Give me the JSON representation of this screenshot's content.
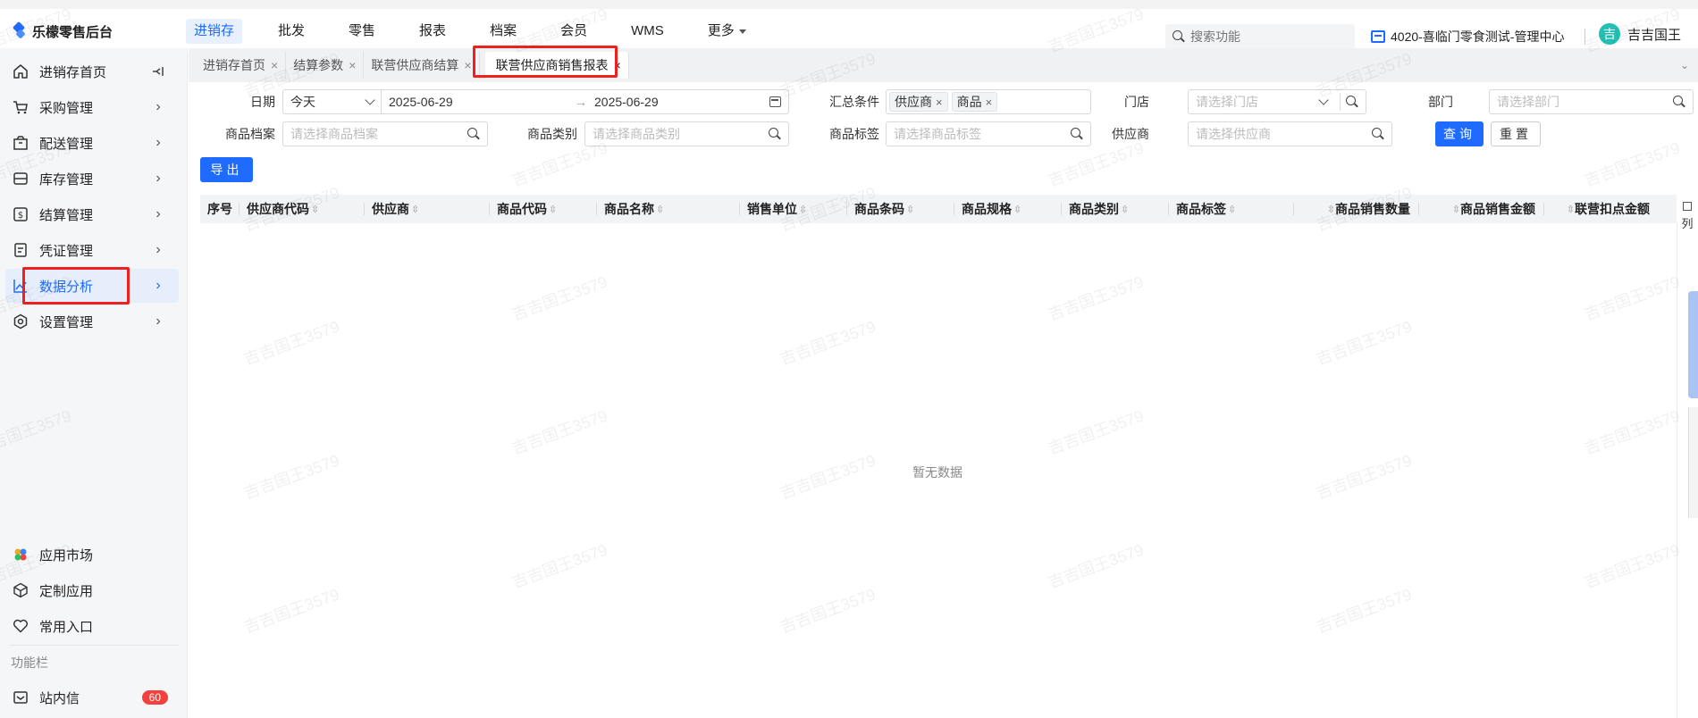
{
  "app": {
    "title": "乐檬零售后台"
  },
  "topnav": {
    "items": [
      "进销存",
      "批发",
      "零售",
      "报表",
      "档案",
      "会员",
      "WMS",
      "更多"
    ],
    "active": "进销存"
  },
  "search": {
    "placeholder": "搜索功能"
  },
  "org": {
    "name": "4020-喜临门零食测试-管理中心"
  },
  "user": {
    "avatar_char": "吉",
    "name": "吉吉国王"
  },
  "sidebar": {
    "items": [
      {
        "label": "进销存首页",
        "icon": "home-icon"
      },
      {
        "label": "采购管理",
        "icon": "cart-icon"
      },
      {
        "label": "配送管理",
        "icon": "box-icon"
      },
      {
        "label": "库存管理",
        "icon": "inventory-icon"
      },
      {
        "label": "结算管理",
        "icon": "dollar-icon"
      },
      {
        "label": "凭证管理",
        "icon": "document-icon"
      },
      {
        "label": "数据分析",
        "icon": "chart-icon"
      },
      {
        "label": "设置管理",
        "icon": "settings-icon"
      }
    ],
    "bottom": [
      {
        "label": "应用市场",
        "icon": "app-market-icon"
      },
      {
        "label": "定制应用",
        "icon": "cube-icon"
      },
      {
        "label": "常用入口",
        "icon": "heart-icon"
      }
    ],
    "section_title": "功能栏",
    "inbox": {
      "label": "站内信",
      "count": "60"
    },
    "active_label": "数据分析"
  },
  "tabs": [
    {
      "label": "进销存首页"
    },
    {
      "label": "结算参数"
    },
    {
      "label": "联营供应商结算"
    },
    {
      "label": "联营供应商销售报表",
      "active": true
    }
  ],
  "filters": {
    "date_label": "日期",
    "date_preset": "今天",
    "date_start": "2025-06-29",
    "date_end": "2025-06-29",
    "summary_label": "汇总条件",
    "summary_tags": [
      "供应商",
      "商品"
    ],
    "store_label": "门店",
    "store_placeholder": "请选择门店",
    "dept_label": "部门",
    "dept_placeholder": "请选择部门",
    "product_label": "商品档案",
    "product_placeholder": "请选择商品档案",
    "category_label": "商品类别",
    "category_placeholder": "请选择商品类别",
    "tag_label": "商品标签",
    "tag_placeholder": "请选择商品标签",
    "supplier_label": "供应商",
    "supplier_placeholder": "请选择供应商",
    "query_btn": "查询",
    "reset_btn": "重置",
    "export_btn": "导出"
  },
  "table": {
    "columns": [
      "序号",
      "供应商代码",
      "供应商",
      "商品代码",
      "商品名称",
      "销售单位",
      "商品条码",
      "商品规格",
      "商品类别",
      "商品标签",
      "商品销售数量",
      "商品销售金额",
      "联营扣点金额"
    ],
    "empty_text": "暂无数据",
    "column_setting": "列"
  },
  "watermark": "吉吉国王3579",
  "colors": {
    "accent": "#1f6bff",
    "highlight": "#f0201c",
    "badge": "#f5403b"
  }
}
